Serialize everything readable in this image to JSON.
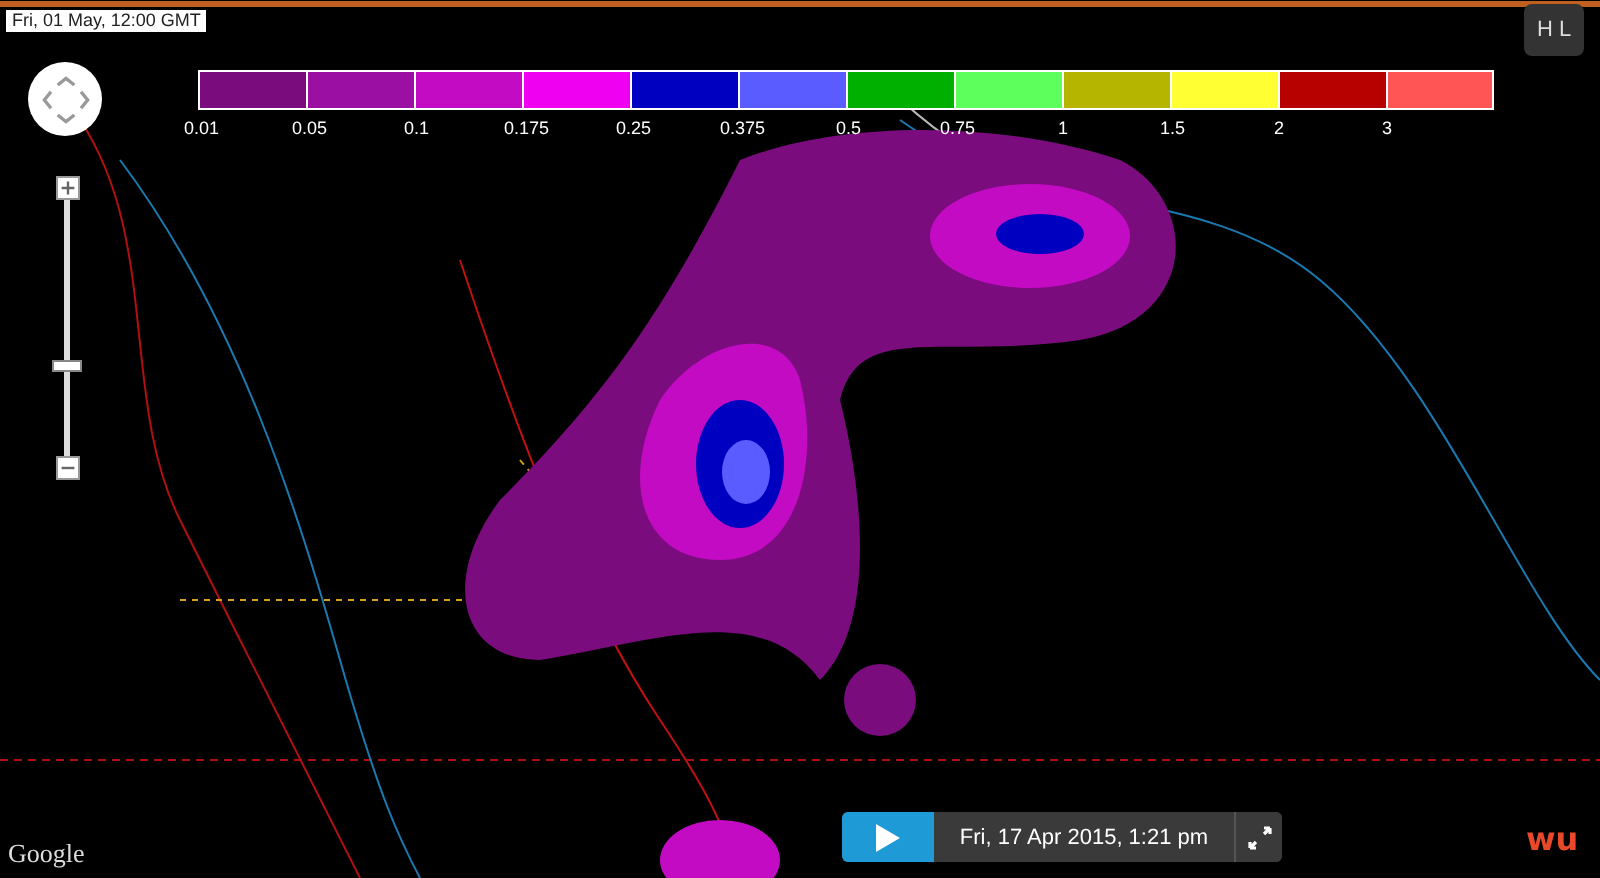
{
  "timestamp": "Fri, 01 May, 12:00 GMT",
  "legend": {
    "stops": [
      {
        "label": "0.01",
        "color": "#7a0c7e"
      },
      {
        "label": "0.05",
        "color": "#9b0fa3"
      },
      {
        "label": "0.1",
        "color": "#c40bc4"
      },
      {
        "label": "0.175",
        "color": "#f000f0"
      },
      {
        "label": "0.25",
        "color": "#0000c0"
      },
      {
        "label": "0.375",
        "color": "#5b5cff"
      },
      {
        "label": "0.5",
        "color": "#00b000"
      },
      {
        "label": "0.75",
        "color": "#5cff5c"
      },
      {
        "label": "1",
        "color": "#b5b500"
      },
      {
        "label": "1.5",
        "color": "#ffff33"
      },
      {
        "label": "2",
        "color": "#b70000"
      },
      {
        "label": "3",
        "color": "#ff5555"
      }
    ]
  },
  "hl_button": {
    "label": "H L"
  },
  "zoom": {
    "level": 0.35
  },
  "player": {
    "date": "Fri, 17 Apr 2015, 1:21 pm"
  },
  "map_logo": "Google",
  "brand_logo": "wu"
}
